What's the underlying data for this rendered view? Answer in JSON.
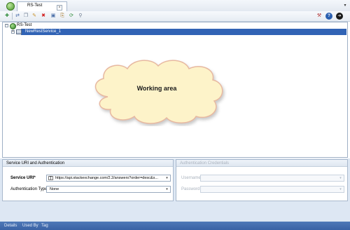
{
  "window": {
    "tab_title": "RS-Test",
    "close_glyph": "×",
    "dropdown_glyph": "▾"
  },
  "toolbar": {
    "buttons": [
      {
        "name": "new-icon",
        "glyph": "✚",
        "color": "#2e8b3a"
      },
      {
        "name": "service-icon",
        "glyph": "⇄",
        "color": "#3a5fa0"
      },
      {
        "name": "copy-icon",
        "glyph": "❐",
        "color": "#6b7a8f"
      },
      {
        "name": "edit-icon",
        "glyph": "✎",
        "color": "#c8902a"
      },
      {
        "name": "delete-icon",
        "glyph": "✖",
        "color": "#d22020"
      },
      {
        "name": "save-icon",
        "glyph": "▣",
        "color": "#4a6fa8"
      },
      {
        "name": "import-icon",
        "glyph": "⎘",
        "color": "#a8782a"
      },
      {
        "name": "refresh-icon",
        "glyph": "⟳",
        "color": "#2e8b3a"
      },
      {
        "name": "search-icon",
        "glyph": "⚲",
        "color": "#6b7a8f"
      }
    ],
    "right_buttons": [
      {
        "name": "tools-icon",
        "glyph": "⚒",
        "color": "#b03030"
      },
      {
        "name": "help-icon",
        "glyph": "?",
        "color": "#2a5fb0"
      },
      {
        "name": "forward-icon",
        "glyph": "➔",
        "color": "#1a1a1a"
      }
    ]
  },
  "tree": {
    "root_label": "RS-Test",
    "child_label": "NewRestService_1",
    "expander_glyph": "−"
  },
  "working_area": {
    "label": "Working area"
  },
  "service_panel": {
    "title": "Service URI and Authentication",
    "uri_label": "Service URI*",
    "uri_value": "https://api.stackexchange.com/2.2/answers?order=desc&s...",
    "auth_label": "Authentication Type",
    "auth_value": "None"
  },
  "credentials_panel": {
    "title": "Authentication Credentials",
    "username_label": "Username",
    "password_label": "Password"
  },
  "status_tabs": [
    "Details",
    "Used By",
    "Tag"
  ],
  "colors": {
    "selection": "#3163b5",
    "status_bar": "#3a62a5",
    "cloud_fill": "#fdf3c9",
    "cloud_stroke": "#e7b8a0"
  }
}
